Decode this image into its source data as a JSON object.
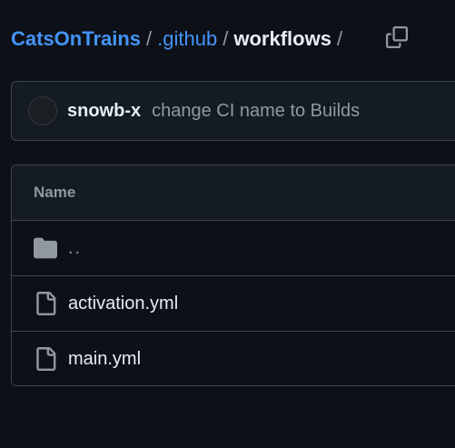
{
  "breadcrumb": {
    "repo": "CatsOnTrains",
    "folder": ".github",
    "current": "workflows",
    "separator": "/",
    "trailing_separator": "/",
    "copy_icon": "copy-icon"
  },
  "commit": {
    "author": "snowb-x",
    "message": "change CI name to Builds"
  },
  "table": {
    "header": "Name",
    "rows": [
      {
        "label": "..",
        "icon": "folder-icon"
      },
      {
        "label": "activation.yml",
        "icon": "file-icon"
      },
      {
        "label": "main.yml",
        "icon": "file-icon"
      }
    ]
  },
  "colors": {
    "background": "#0d1117",
    "link": "#4493f8",
    "muted": "#9198a1",
    "border": "#3d444d"
  }
}
